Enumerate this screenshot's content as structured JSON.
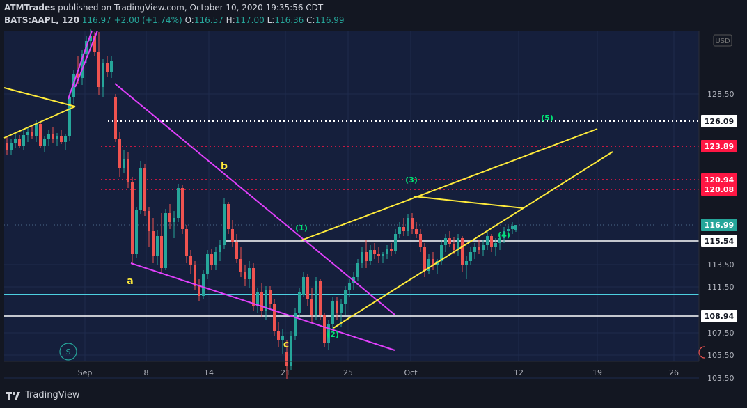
{
  "header": {
    "author": "ATMTrades",
    "published": "published on TradingView.com, October 10, 2020 19:35:56 CDT",
    "symbol": "BATS:AAPL, 120",
    "last": "116.97",
    "change": "+2.00 (+1.74%)",
    "o_label": "O:",
    "o": "116.57",
    "h_label": "H:",
    "h": "117.00",
    "l_label": "L:",
    "l": "116.36",
    "c_label": "C:",
    "c": "116.99"
  },
  "brand": {
    "name": "TradingView"
  },
  "currency": "USD",
  "colors": {
    "background": "#131722",
    "up": "#26a69a",
    "down": "#ef5350",
    "wedge": "#e040fb",
    "trend": "#ffeb3b",
    "support_zone": "#2e5e4e",
    "cyan": "#4dd0e1",
    "red_level": "#ff1744"
  },
  "chart_data": {
    "type": "candlestick",
    "x_ticks": [
      "Sep",
      "8",
      "14",
      "21",
      "25",
      "Oct",
      "12",
      "19",
      "26"
    ],
    "y_ticks": [
      "103.50",
      "105.50",
      "107.50",
      "111.50",
      "113.50",
      "128.50"
    ],
    "ylim": [
      102.5,
      134
    ],
    "levels": [
      {
        "price": 126.09,
        "label": "126.09",
        "style": "white-dotted"
      },
      {
        "price": 123.89,
        "label": "123.89",
        "style": "red-dotted"
      },
      {
        "price": 120.94,
        "label": "120.94",
        "style": "red-dotted"
      },
      {
        "price": 120.08,
        "label": "120.08",
        "style": "red-dotted"
      },
      {
        "price": 116.99,
        "label": "116.99",
        "style": "current"
      },
      {
        "price": 115.54,
        "label": "115.54",
        "style": "white-solid"
      },
      {
        "price": 108.94,
        "label": "108.94",
        "style": "white-solid"
      }
    ],
    "wave_labels": [
      {
        "text": "a",
        "color": "yellow"
      },
      {
        "text": "b",
        "color": "yellow"
      },
      {
        "text": "c",
        "color": "yellow"
      },
      {
        "text": "(1)",
        "color": "green"
      },
      {
        "text": "(2)",
        "color": "green"
      },
      {
        "text": "(3)",
        "color": "green"
      },
      {
        "text": "(4)",
        "color": "green"
      },
      {
        "text": "(5)",
        "color": "green"
      }
    ],
    "markers": {
      "s_label": "S"
    }
  }
}
